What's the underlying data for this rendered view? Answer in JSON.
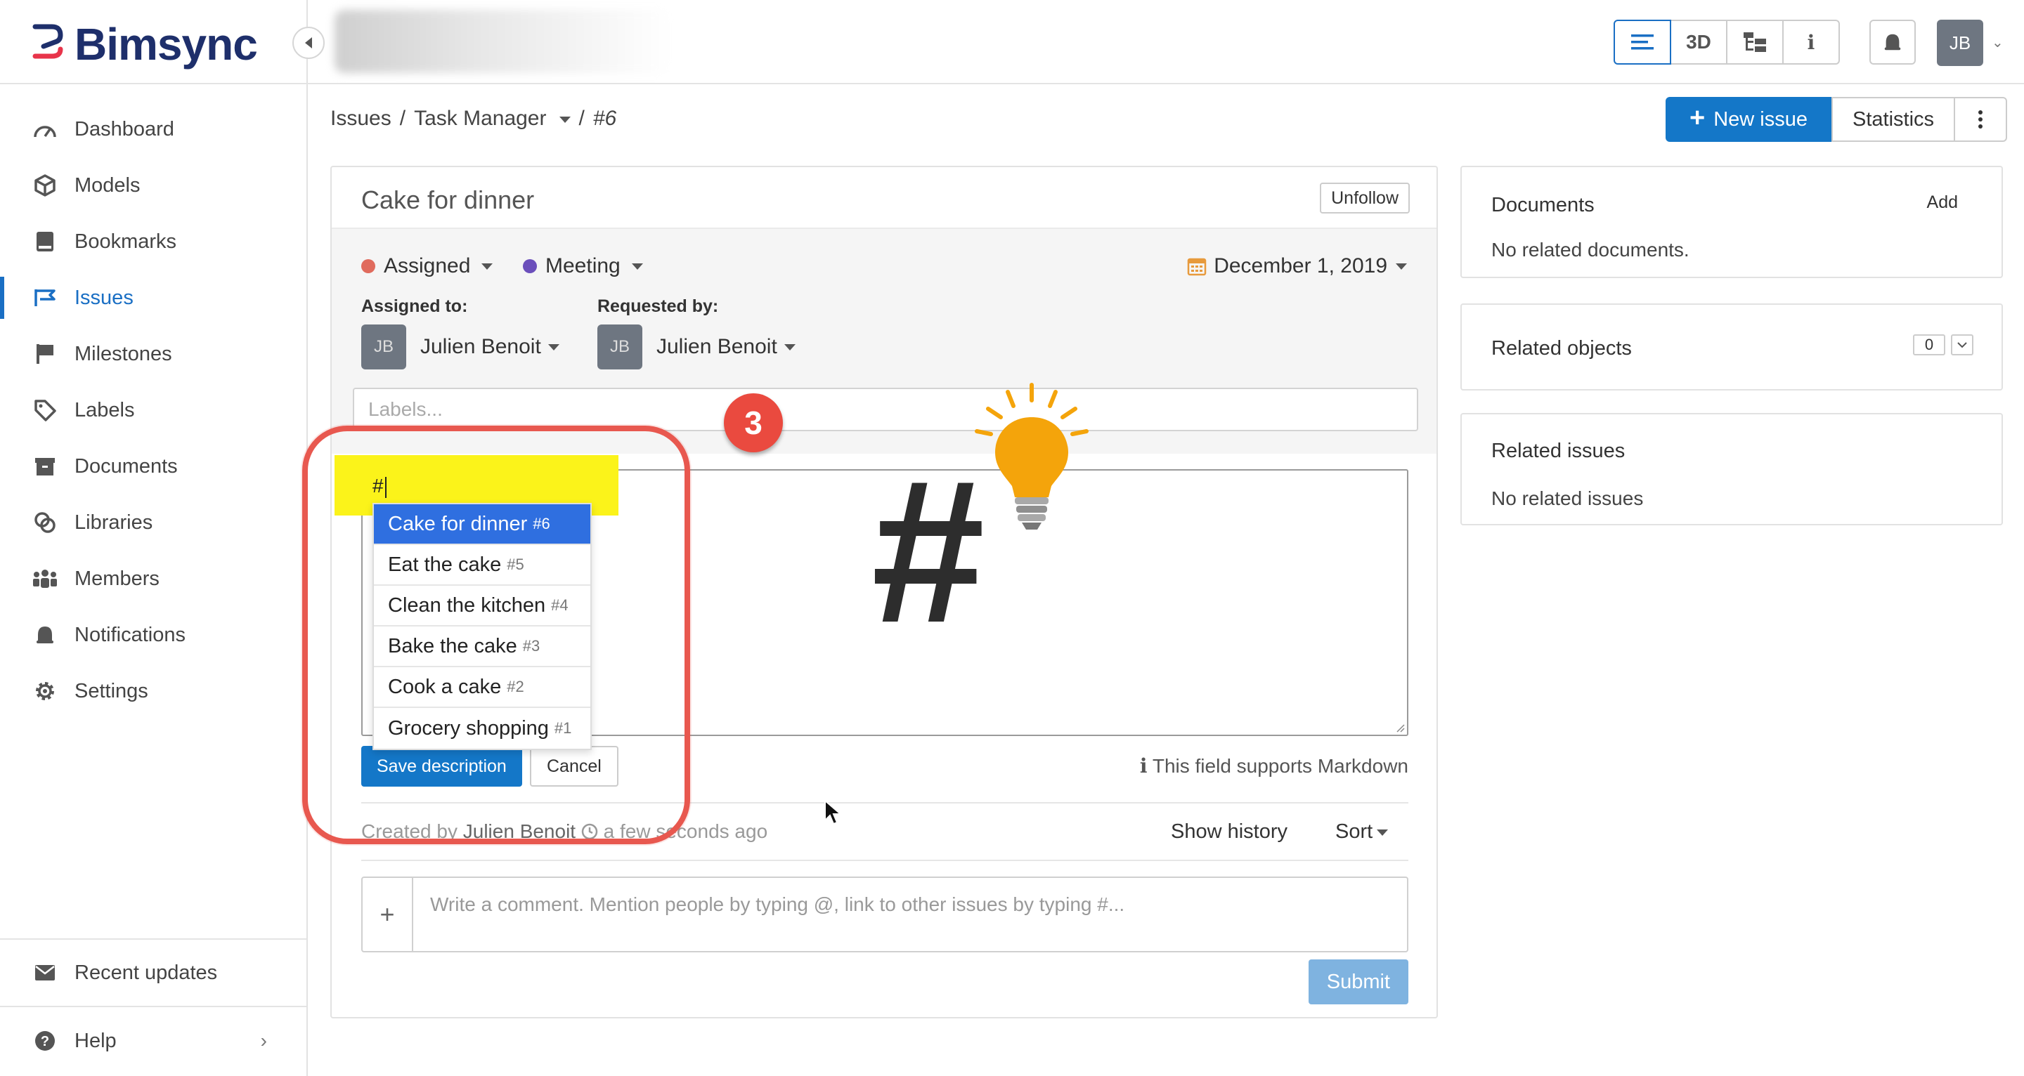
{
  "app": {
    "name": "Bimsync"
  },
  "sidebar": {
    "items": [
      {
        "label": "Dashboard",
        "icon": "dashboard-icon"
      },
      {
        "label": "Models",
        "icon": "cube-icon"
      },
      {
        "label": "Bookmarks",
        "icon": "bookmark-icon"
      },
      {
        "label": "Issues",
        "icon": "issues-icon",
        "active": true
      },
      {
        "label": "Milestones",
        "icon": "flag-icon"
      },
      {
        "label": "Labels",
        "icon": "tag-icon"
      },
      {
        "label": "Documents",
        "icon": "archive-icon"
      },
      {
        "label": "Libraries",
        "icon": "library-icon"
      },
      {
        "label": "Members",
        "icon": "members-icon"
      },
      {
        "label": "Notifications",
        "icon": "bell-icon"
      },
      {
        "label": "Settings",
        "icon": "gear-icon"
      }
    ],
    "recent_updates": "Recent updates",
    "help": "Help"
  },
  "topbar": {
    "view_buttons": [
      "list",
      "3D",
      "tree",
      "i"
    ],
    "avatar_initials": "JB"
  },
  "breadcrumb": {
    "root": "Issues",
    "sep": "/",
    "board": "Task Manager",
    "current": "#6"
  },
  "actions": {
    "new_issue": "New issue",
    "statistics": "Statistics"
  },
  "issue": {
    "title": "Cake for dinner",
    "unfollow": "Unfollow",
    "status": "Assigned",
    "status_color": "#e06b5d",
    "type": "Meeting",
    "type_color": "#6b4fbb",
    "date": "December 1, 2019",
    "assigned_label": "Assigned to:",
    "requested_label": "Requested by:",
    "assignee": {
      "initials": "JB",
      "name": "Julien Benoit"
    },
    "requester": {
      "initials": "JB",
      "name": "Julien Benoit"
    },
    "labels_placeholder": "Labels...",
    "description_typed": "#",
    "suggestions": [
      {
        "title": "Cake for dinner",
        "num": "#6",
        "selected": true
      },
      {
        "title": "Eat the cake",
        "num": "#5"
      },
      {
        "title": "Clean the kitchen",
        "num": "#4"
      },
      {
        "title": "Bake the cake",
        "num": "#3"
      },
      {
        "title": "Cook a cake",
        "num": "#2"
      },
      {
        "title": "Grocery shopping",
        "num": "#1"
      }
    ],
    "save_description": "Save description",
    "cancel": "Cancel",
    "markdown_note": "This field supports Markdown",
    "created_prefix": "Created by",
    "created_by": "Julien Benoit",
    "created_when": "a few seconds ago",
    "show_history": "Show history",
    "sort": "Sort",
    "comment_placeholder": "Write a comment. Mention people by typing @, link to other issues by typing #...",
    "submit": "Submit"
  },
  "panels": {
    "documents": {
      "title": "Documents",
      "add": "Add",
      "empty": "No related documents."
    },
    "related_objects": {
      "title": "Related objects",
      "count": "0"
    },
    "related_issues": {
      "title": "Related issues",
      "empty": "No related issues"
    }
  },
  "annotation": {
    "step": "3",
    "symbol": "#",
    "callout_color": "#e8584f",
    "highlight_color": "#fbf31a"
  }
}
